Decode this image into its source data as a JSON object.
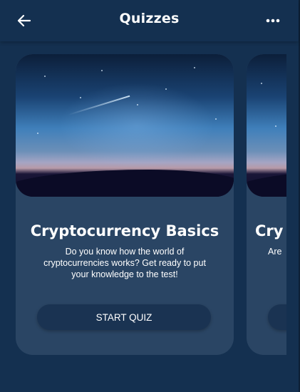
{
  "header": {
    "title": "Quizzes",
    "back_icon": "arrow-left-icon",
    "more_icon": "more-horizontal-icon"
  },
  "cards": [
    {
      "title": "Cryptocurrency Basics",
      "description": "Do you know how the world of cryptocurrencies works? Get ready to put your knowledge to the test!",
      "button_label": "START QUIZ"
    },
    {
      "title": "Cry",
      "description": "Are",
      "button_label": ""
    }
  ],
  "colors": {
    "background": "#143050",
    "card": "#2a4564",
    "button": "#1a3352",
    "text": "#ffffff"
  }
}
